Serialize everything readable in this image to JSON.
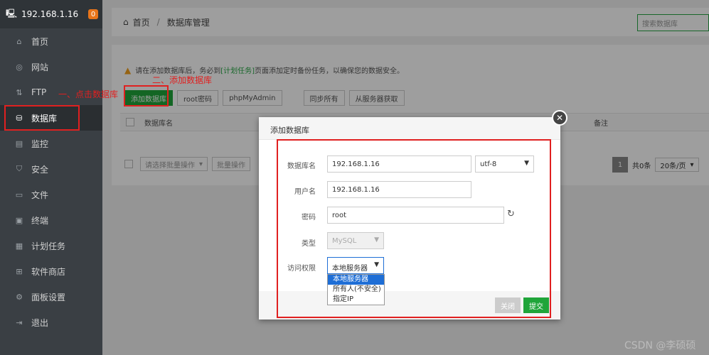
{
  "sidebar": {
    "ip": "192.168.1.16",
    "badge": "0",
    "items": [
      {
        "label": "首页",
        "icon": "home-icon",
        "glyph": "⌂"
      },
      {
        "label": "网站",
        "icon": "globe-icon",
        "glyph": "◎"
      },
      {
        "label": "FTP",
        "icon": "ftp-icon",
        "glyph": "⇅"
      },
      {
        "label": "数据库",
        "icon": "database-icon",
        "glyph": "⛁"
      },
      {
        "label": "监控",
        "icon": "monitor-icon",
        "glyph": "▤"
      },
      {
        "label": "安全",
        "icon": "shield-icon",
        "glyph": "⛉"
      },
      {
        "label": "文件",
        "icon": "folder-icon",
        "glyph": "▭"
      },
      {
        "label": "终端",
        "icon": "terminal-icon",
        "glyph": "▣"
      },
      {
        "label": "计划任务",
        "icon": "calendar-icon",
        "glyph": "▦"
      },
      {
        "label": "软件商店",
        "icon": "grid-icon",
        "glyph": "⊞"
      },
      {
        "label": "面板设置",
        "icon": "gear-icon",
        "glyph": "⚙"
      },
      {
        "label": "退出",
        "icon": "logout-icon",
        "glyph": "⇥"
      }
    ]
  },
  "header": {
    "home": "首页",
    "page": "数据库管理",
    "search_placeholder": "搜索数据库"
  },
  "notice": {
    "before": "请在添加数据库后，务必到",
    "link": "[计划任务]",
    "after": "页面添加定时备份任务，以确保您的数据安全。"
  },
  "toolbar": {
    "add": "添加数据库",
    "root": "root密码",
    "pma": "phpMyAdmin",
    "sync": "同步所有",
    "fetch": "从服务器获取"
  },
  "table": {
    "col_name": "数据库名",
    "col_note": "备注"
  },
  "bottom": {
    "batch_select": "请选择批量操作",
    "batch_btn": "批量操作"
  },
  "pager": {
    "page": "1",
    "total": "共0条",
    "per_page": "20条/页"
  },
  "annotations": {
    "step1": "一、点击数据库",
    "step2": "二、添加数据库"
  },
  "modal": {
    "title": "添加数据库",
    "close": "✕",
    "name_label": "数据库名",
    "name_value": "192.168.1.16",
    "charset": "utf-8",
    "user_label": "用户名",
    "user_value": "192.168.1.16",
    "pass_label": "密码",
    "pass_value": "root",
    "type_label": "类型",
    "type_value": "MySQL",
    "access_label": "访问权限",
    "access_value": "本地服务器",
    "access_options": [
      "本地服务器",
      "所有人(不安全)",
      "指定IP"
    ],
    "cancel": "关闭",
    "submit": "提交"
  },
  "watermark": "CSDN @李硕硕",
  "colors": {
    "accent": "#20a53a",
    "annotation": "#e02020",
    "sidebar": "#3a3f44"
  }
}
